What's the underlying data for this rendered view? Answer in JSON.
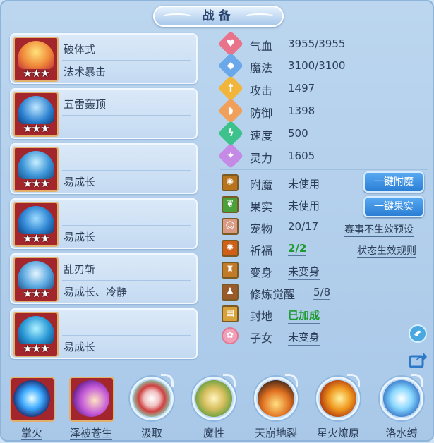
{
  "title": "战备",
  "skill_cards": [
    {
      "line1": "破体式",
      "line2": "法术暴击",
      "stars": "★★★",
      "icon": "popsicle-skill-icon"
    },
    {
      "line1": "五雷轰顶",
      "line2": "",
      "stars": "★★★",
      "icon": "thunder-pet-icon"
    },
    {
      "line1": "",
      "line2": "易成长",
      "stars": "★★★",
      "icon": "armor-pet-icon"
    },
    {
      "line1": "",
      "line2": "易成长",
      "stars": "★★★",
      "icon": "swirl-pet-icon"
    },
    {
      "line1": "乱刃斩",
      "line2": "易成长、冷静",
      "stars": "★★★",
      "icon": "blade-pet-icon"
    },
    {
      "line1": "",
      "line2": "易成长",
      "stars": "★★★",
      "icon": "crystal-pet-icon"
    }
  ],
  "stats": [
    {
      "label": "气血",
      "value": "3955/3955",
      "icon": "heart-icon",
      "color": "#e9738b"
    },
    {
      "label": "魔法",
      "value": "3100/3100",
      "icon": "mana-shield-icon",
      "color": "#6aa8ea"
    },
    {
      "label": "攻击",
      "value": "1497",
      "icon": "sword-icon",
      "color": "#f0b53a"
    },
    {
      "label": "防御",
      "value": "1398",
      "icon": "shield-icon",
      "color": "#f0a05a"
    },
    {
      "label": "速度",
      "value": "500",
      "icon": "lightning-icon",
      "color": "#3cc28a"
    },
    {
      "label": "灵力",
      "value": "1605",
      "icon": "spirit-icon",
      "color": "#c58ae6"
    }
  ],
  "rows": [
    {
      "label": "附魔",
      "value": "未使用",
      "icon": "enchant-icon"
    },
    {
      "label": "果实",
      "value": "未使用",
      "icon": "fruit-icon"
    },
    {
      "label": "宠物",
      "value": "20/17",
      "icon": "pet-portrait-icon"
    },
    {
      "label": "祈福",
      "value": "2/2",
      "icon": "bless-icon"
    },
    {
      "label": "变身",
      "value": "未变身",
      "icon": "transform-icon"
    },
    {
      "label": "修炼觉醒",
      "value": "5/8",
      "icon": "cultivate-icon"
    },
    {
      "label": "封地",
      "value": "已加成",
      "icon": "fief-icon"
    },
    {
      "label": "子女",
      "value": "未变身",
      "icon": "child-icon"
    }
  ],
  "buttons": {
    "enchant": "一键附魔",
    "fruit": "一键果实"
  },
  "links": {
    "preset": "赛事不生效预设",
    "rules": "状态生效规则"
  },
  "bottom_skills": [
    {
      "label": "掌火",
      "icon": "palm-fire-icon",
      "style": "square"
    },
    {
      "label": "泽被苍生",
      "icon": "blessing-hand-icon",
      "style": "square"
    },
    {
      "label": "汲取",
      "icon": "absorb-icon",
      "style": "ring"
    },
    {
      "label": "魔性",
      "icon": "demonic-icon",
      "style": "ring"
    },
    {
      "label": "天崩地裂",
      "icon": "earthquake-icon",
      "style": "ring"
    },
    {
      "label": "星火燎原",
      "icon": "starfire-icon",
      "style": "ring"
    },
    {
      "label": "洛水缚",
      "icon": "water-bind-icon",
      "style": "ring"
    }
  ]
}
